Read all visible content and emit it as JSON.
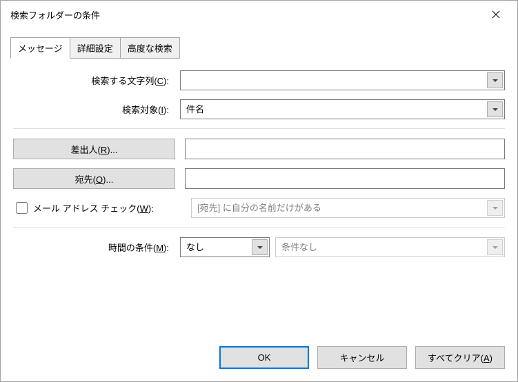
{
  "title": "検索フォルダーの条件",
  "tabs": {
    "message": "メッセージ",
    "advanced": "詳細設定",
    "more": "高度な検索"
  },
  "labels": {
    "search_text_prefix": "検索する文字列(",
    "search_text_key": "C",
    "search_text_suffix": "):",
    "search_target_prefix": "検索対象(",
    "search_target_key": "I",
    "search_target_suffix": "):",
    "from_prefix": "差出人(",
    "from_key": "R",
    "from_suffix": ")...",
    "to_prefix": "宛先(",
    "to_key": "O",
    "to_suffix": ")...",
    "addr_check_prefix": "メール アドレス チェック(",
    "addr_check_key": "W",
    "addr_check_suffix": "):",
    "time_cond_prefix": "時間の条件(",
    "time_cond_key": "M",
    "time_cond_suffix": "):"
  },
  "values": {
    "search_text": "",
    "search_target": "件名",
    "from_text": "",
    "to_text": "",
    "addr_select": "[宛先] に自分の名前だけがある",
    "time_cond": "なし",
    "time_cond_detail": "条件なし"
  },
  "buttons": {
    "ok": "OK",
    "cancel": "キャンセル",
    "clear_prefix": "すべてクリア(",
    "clear_key": "A",
    "clear_suffix": ")"
  }
}
